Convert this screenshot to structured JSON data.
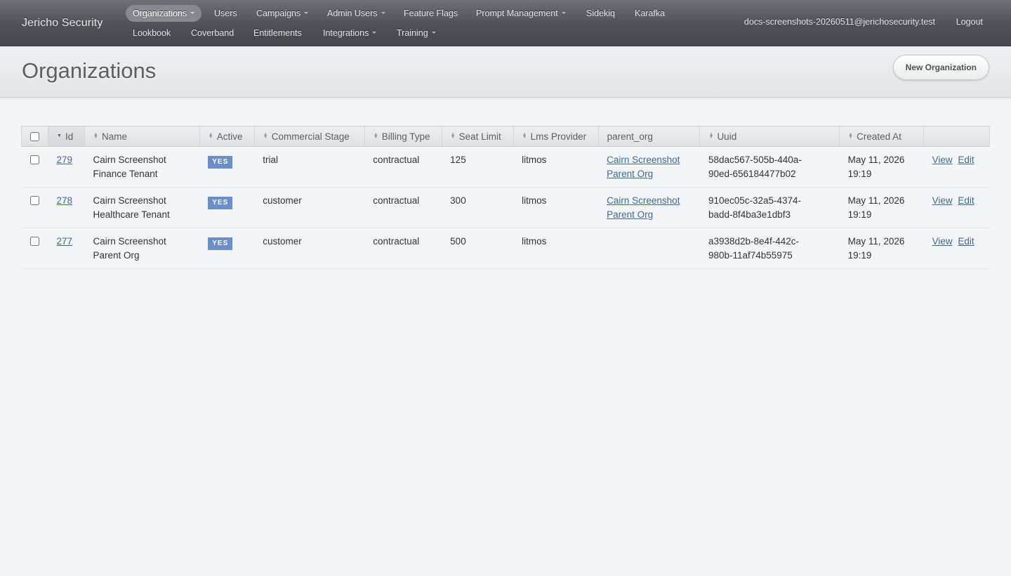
{
  "header": {
    "site_title": "Jericho Security",
    "nav_row1": [
      {
        "label": "Organizations",
        "dropdown": true,
        "active": true
      },
      {
        "label": "Users",
        "dropdown": false
      },
      {
        "label": "Campaigns",
        "dropdown": true
      },
      {
        "label": "Admin Users",
        "dropdown": true
      },
      {
        "label": "Feature Flags",
        "dropdown": false
      },
      {
        "label": "Prompt Management",
        "dropdown": true
      },
      {
        "label": "Sidekiq",
        "dropdown": false
      },
      {
        "label": "Karafka",
        "dropdown": false
      }
    ],
    "nav_row2": [
      {
        "label": "Lookbook",
        "dropdown": false
      },
      {
        "label": "Coverband",
        "dropdown": false
      },
      {
        "label": "Entitlements",
        "dropdown": false
      },
      {
        "label": "Integrations",
        "dropdown": true
      },
      {
        "label": "Training",
        "dropdown": true
      }
    ],
    "user_email": "docs-screenshots-20260511@jerichosecurity.test",
    "logout_label": "Logout"
  },
  "title_bar": {
    "title": "Organizations",
    "new_button_label": "New Organization"
  },
  "table": {
    "columns": [
      {
        "key": "id",
        "label": "Id",
        "sortable": true,
        "sorted": "desc"
      },
      {
        "key": "name",
        "label": "Name",
        "sortable": true
      },
      {
        "key": "active",
        "label": "Active",
        "sortable": true
      },
      {
        "key": "commercial_stage",
        "label": "Commercial Stage",
        "sortable": true
      },
      {
        "key": "billing_type",
        "label": "Billing Type",
        "sortable": true
      },
      {
        "key": "seat_limit",
        "label": "Seat Limit",
        "sortable": true
      },
      {
        "key": "lms_provider",
        "label": "Lms Provider",
        "sortable": true
      },
      {
        "key": "parent_org",
        "label": "parent_org",
        "sortable": false
      },
      {
        "key": "uuid",
        "label": "Uuid",
        "sortable": true
      },
      {
        "key": "created_at",
        "label": "Created At",
        "sortable": true
      }
    ],
    "rows": [
      {
        "id": "279",
        "name_lines": [
          "Cairn Screenshot",
          "Finance Tenant"
        ],
        "active": "YES",
        "commercial_stage": "trial",
        "billing_type": "contractual",
        "seat_limit": "125",
        "lms_provider": "litmos",
        "parent_org_lines": [
          "Cairn Screenshot",
          "Parent Org"
        ],
        "uuid_lines": [
          "58dac567-505b-440a-",
          "90ed-656184477b02"
        ],
        "created_lines": [
          "May 11, 2026",
          "19:19"
        ],
        "view_label": "View",
        "edit_label": "Edit"
      },
      {
        "id": "278",
        "name_lines": [
          "Cairn Screenshot",
          "Healthcare Tenant"
        ],
        "active": "YES",
        "commercial_stage": "customer",
        "billing_type": "contractual",
        "seat_limit": "300",
        "lms_provider": "litmos",
        "parent_org_lines": [
          "Cairn Screenshot",
          "Parent Org"
        ],
        "uuid_lines": [
          "910ec05c-32a5-4374-",
          "badd-8f4ba3e1dbf3"
        ],
        "created_lines": [
          "May 11, 2026",
          "19:19"
        ],
        "view_label": "View",
        "edit_label": "Edit"
      },
      {
        "id": "277",
        "name_lines": [
          "Cairn Screenshot",
          "Parent Org"
        ],
        "active": "YES",
        "commercial_stage": "customer",
        "billing_type": "contractual",
        "seat_limit": "500",
        "lms_provider": "litmos",
        "parent_org_lines": [],
        "uuid_lines": [
          "a3938d2b-8e4f-442c-",
          "980b-11af74b55975"
        ],
        "created_lines": [
          "May 11, 2026",
          "19:19"
        ],
        "view_label": "View",
        "edit_label": "Edit"
      }
    ]
  },
  "colors": {
    "header_bg": "#4e5256",
    "link": "#3f6a93",
    "status_yes": "#6b8ec9",
    "page_bg": "#f3f4f6"
  }
}
